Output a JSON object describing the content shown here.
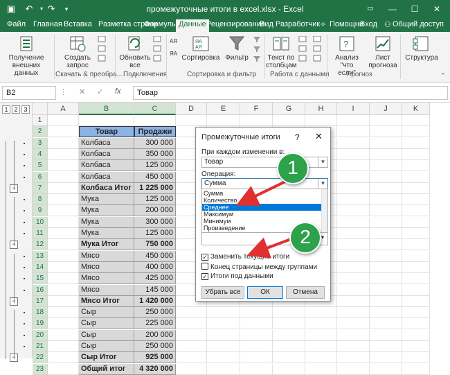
{
  "window": {
    "title": "промежуточные итоги в excel.xlsx - Excel",
    "minimize": "—",
    "maximize": "☐",
    "close": "✕"
  },
  "tabs": [
    "Файл",
    "Главная",
    "Вставка",
    "Разметка страни",
    "Формулы",
    "Данные",
    "Рецензирование",
    "Вид",
    "Разработчик"
  ],
  "tab_right": {
    "help": "Помощни",
    "signin": "Вход",
    "share": "Общий доступ"
  },
  "ribbon": {
    "get_data": "Получение\nвнешних данных",
    "create_query": "Создать\nзапрос",
    "refresh_all": "Обновить\nвсе",
    "sort": "Сортировка",
    "filter": "Фильтр",
    "text_to_cols": "Текст по\nстолбцам",
    "whatif": "Анализ \"что\nесли\"",
    "forecast": "Лист\nпрогноза",
    "structure": "Структура",
    "group_get": "Скачать & преобра...",
    "group_conn": "Подключения",
    "group_sort": "Сортировка и фильтр",
    "group_data": "Работа с данными",
    "group_forecast": "Прогноз"
  },
  "formula_bar": {
    "cell_ref": "B2",
    "fx": "fx",
    "value": "Товар"
  },
  "outline_levels": [
    "1",
    "2",
    "3"
  ],
  "columns": [
    "A",
    "B",
    "C",
    "D",
    "E",
    "F",
    "G",
    "H",
    "I",
    "J",
    "K"
  ],
  "rows": [
    {
      "n": "1",
      "b": "",
      "c": "",
      "type": "empty"
    },
    {
      "n": "2",
      "b": "Товар",
      "c": "Продажи",
      "type": "header"
    },
    {
      "n": "3",
      "b": "Колбаса",
      "c": "300 000",
      "type": "data"
    },
    {
      "n": "4",
      "b": "Колбаса",
      "c": "350 000",
      "type": "data"
    },
    {
      "n": "5",
      "b": "Колбаса",
      "c": "125 000",
      "type": "data"
    },
    {
      "n": "6",
      "b": "Колбаса",
      "c": "450 000",
      "type": "data"
    },
    {
      "n": "7",
      "b": "Колбаса Итог",
      "c": "1 225 000",
      "type": "total"
    },
    {
      "n": "8",
      "b": "Мука",
      "c": "125 000",
      "type": "data"
    },
    {
      "n": "9",
      "b": "Мука",
      "c": "200 000",
      "type": "data"
    },
    {
      "n": "10",
      "b": "Мука",
      "c": "300 000",
      "type": "data"
    },
    {
      "n": "11",
      "b": "Мука",
      "c": "125 000",
      "type": "data"
    },
    {
      "n": "12",
      "b": "Мука Итог",
      "c": "750 000",
      "type": "total"
    },
    {
      "n": "13",
      "b": "Мясо",
      "c": "450 000",
      "type": "data"
    },
    {
      "n": "14",
      "b": "Мясо",
      "c": "400 000",
      "type": "data"
    },
    {
      "n": "15",
      "b": "Мясо",
      "c": "425 000",
      "type": "data"
    },
    {
      "n": "16",
      "b": "Мясо",
      "c": "145 000",
      "type": "data"
    },
    {
      "n": "17",
      "b": "Мясо Итог",
      "c": "1 420 000",
      "type": "total"
    },
    {
      "n": "18",
      "b": "Сыр",
      "c": "250 000",
      "type": "data"
    },
    {
      "n": "19",
      "b": "Сыр",
      "c": "225 000",
      "type": "data"
    },
    {
      "n": "20",
      "b": "Сыр",
      "c": "200 000",
      "type": "data"
    },
    {
      "n": "21",
      "b": "Сыр",
      "c": "250 000",
      "type": "data"
    },
    {
      "n": "22",
      "b": "Сыр Итог",
      "c": "925 000",
      "type": "total"
    },
    {
      "n": "23",
      "b": "Общий итог",
      "c": "4 320 000",
      "type": "total"
    }
  ],
  "dialog": {
    "title": "Промежуточные итоги",
    "help": "?",
    "close": "✕",
    "label_group": "При каждом изменении в:",
    "group_value": "Товар",
    "label_operation": "Операция:",
    "operation_value": "Сумма",
    "operations": [
      "Сумма",
      "Количество",
      "Среднее",
      "Максимум",
      "Минимум",
      "Произведение"
    ],
    "highlighted": "Среднее",
    "chk_replace": "Заменить текущие итоги",
    "chk_pagebreak": "Конец страницы между группами",
    "chk_below": "Итоги под данными",
    "btn_remove": "Убрать все",
    "btn_ok": "ОК",
    "btn_cancel": "Отмена"
  },
  "callouts": [
    "1",
    "2"
  ],
  "colors": {
    "excel_green": "#217346",
    "table_header": "#8db3e2",
    "table_cell": "#d9d9d9",
    "badge": "#2ca24a",
    "arrow": "#e03030"
  }
}
